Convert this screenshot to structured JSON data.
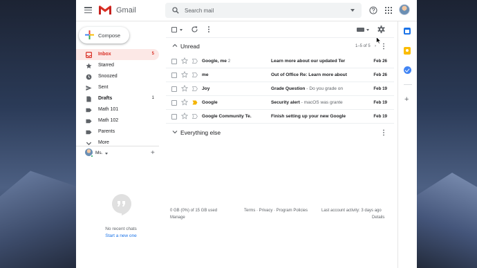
{
  "app": {
    "logo_text": "Gmail"
  },
  "search": {
    "placeholder": "Search mail"
  },
  "compose": {
    "label": "Compose"
  },
  "sidebar": {
    "items": [
      {
        "label": "Inbox",
        "count": "5",
        "icon": "inbox-icon"
      },
      {
        "label": "Starred",
        "count": "",
        "icon": "star-icon"
      },
      {
        "label": "Snoozed",
        "count": "",
        "icon": "clock-icon"
      },
      {
        "label": "Sent",
        "count": "",
        "icon": "send-icon"
      },
      {
        "label": "Drafts",
        "count": "1",
        "icon": "draft-icon"
      },
      {
        "label": "Math 101",
        "count": "",
        "icon": "label-icon"
      },
      {
        "label": "Math 102",
        "count": "",
        "icon": "label-icon"
      },
      {
        "label": "Parents",
        "count": "",
        "icon": "label-icon"
      },
      {
        "label": "More",
        "count": "",
        "icon": "chevron-down-icon"
      }
    ]
  },
  "hangouts": {
    "user_name": "Ms.",
    "empty_text": "No recent chats",
    "start_link": "Start a new one"
  },
  "sections": {
    "unread": {
      "title": "Unread",
      "range": "1–5 of 5"
    },
    "everything_else": {
      "title": "Everything else"
    }
  },
  "emails": [
    {
      "sender": "Google, me",
      "count": "2",
      "subject": "Learn more about our updated Ter",
      "snippet": "",
      "date": "Feb 26",
      "important": false
    },
    {
      "sender": "me",
      "count": "",
      "subject": "Out of Office Re: Learn more about",
      "snippet": "",
      "date": "Feb 26",
      "important": false
    },
    {
      "sender": "Joy",
      "count": "",
      "subject": "Grade Question",
      "snippet": " - Do you grade on",
      "date": "Feb 19",
      "important": false
    },
    {
      "sender": "Google",
      "count": "",
      "subject": "Security alert",
      "snippet": " - macOS was grante",
      "date": "Feb 19",
      "important": true
    },
    {
      "sender": "Google Community Te.",
      "count": "",
      "subject": "Finish setting up your new Google",
      "snippet": "",
      "date": "Feb 19",
      "important": false
    }
  ],
  "footer": {
    "usage": "0 GB (0%) of 15 GB used",
    "manage": "Manage",
    "links": "Terms · Privacy · Program Policies",
    "activity": "Last account activity: 3 days ago",
    "details": "Details"
  },
  "colors": {
    "accent": "#d93025",
    "inbox_highlight": "#fce8e6",
    "link": "#1a73e8",
    "important_marker": "#f4b400"
  }
}
